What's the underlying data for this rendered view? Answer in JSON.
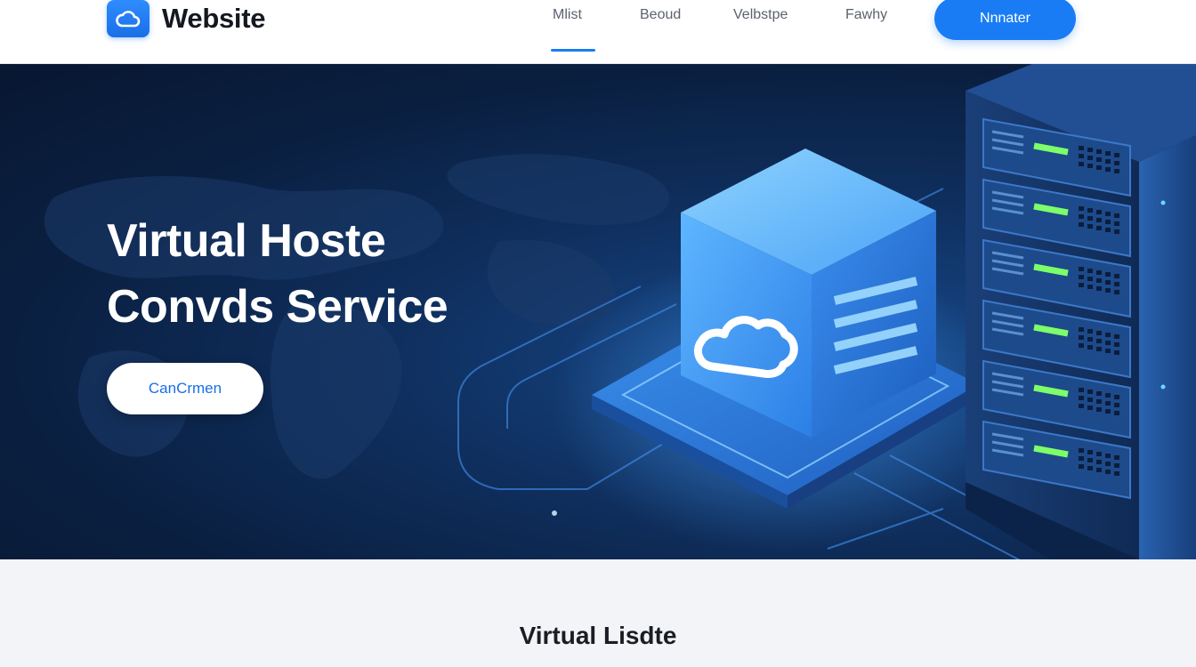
{
  "header": {
    "brand_title": "Website",
    "brand_icon": "cloud-icon",
    "nav": [
      {
        "label": "Mlist"
      },
      {
        "label": "Beoud"
      },
      {
        "label": "Velbstpe"
      },
      {
        "label": "Fawhy"
      }
    ],
    "cta_label": "Nnnater"
  },
  "hero": {
    "title_line1": "Virtual Hoste",
    "title_line2": "Convds Service",
    "button_label": "CanCrmen",
    "illustration_icon": "cloud-cube-icon",
    "server_icon": "server-rack-icon"
  },
  "section": {
    "title": "Virtual Lisdte"
  },
  "colors": {
    "accent": "#1a7cf5",
    "hero_dark": "#0a1f40",
    "led_green": "#7dff6a"
  }
}
